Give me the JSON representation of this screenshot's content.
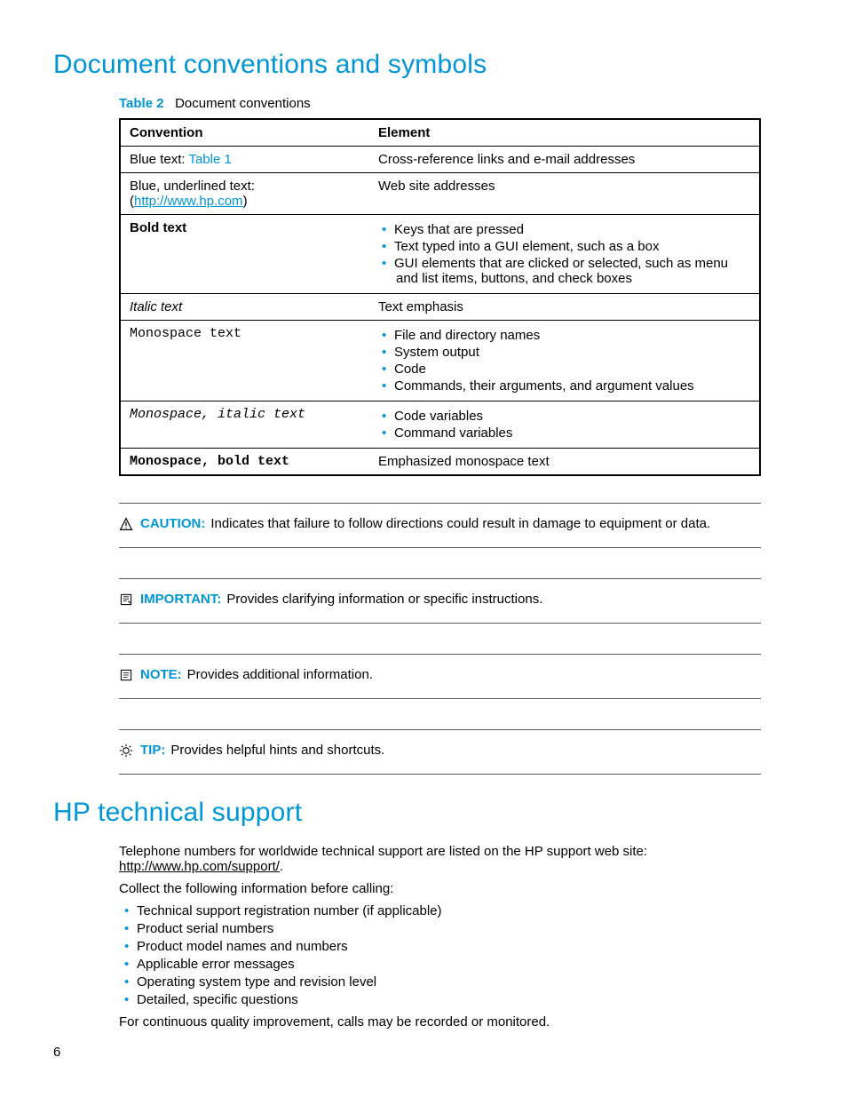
{
  "heading1": "Document conventions and symbols",
  "table_caption_label": "Table 2",
  "table_caption_text": "Document conventions",
  "th1": "Convention",
  "th2": "Element",
  "row1": {
    "conv_prefix": "Blue text: ",
    "conv_link": "Table 1",
    "elem": "Cross-reference links and e-mail addresses"
  },
  "row2": {
    "conv_line1": "Blue, underlined text:",
    "conv_link": "http://www.hp.com",
    "elem": "Web site addresses"
  },
  "row3": {
    "conv": "Bold text",
    "b1": "Keys that are pressed",
    "b2": "Text typed into a GUI element, such as a box",
    "b3": "GUI elements that are clicked or selected, such as menu and list items, buttons, and check boxes"
  },
  "row4": {
    "conv": "Italic text",
    "elem": "Text emphasis"
  },
  "row5": {
    "conv": "Monospace text",
    "b1": "File and directory names",
    "b2": "System output",
    "b3": "Code",
    "b4": "Commands, their arguments, and argument values"
  },
  "row6": {
    "conv": "Monospace, italic text",
    "b1": "Code variables",
    "b2": "Command variables"
  },
  "row7": {
    "conv": "Monospace, bold text",
    "elem": "Emphasized monospace text"
  },
  "adm1": {
    "label": "CAUTION:",
    "text": "Indicates that failure to follow directions could result in damage to equipment or data."
  },
  "adm2": {
    "label": "IMPORTANT:",
    "text": "Provides clarifying information or specific instructions."
  },
  "adm3": {
    "label": "NOTE:",
    "text": "Provides additional information."
  },
  "adm4": {
    "label": "TIP:",
    "text": "Provides helpful hints and shortcuts."
  },
  "heading2": "HP technical support",
  "support_p1a": "Telephone numbers for worldwide technical support are listed on the HP support web site: ",
  "support_link": "http://www.hp.com/support/",
  "support_p1b": ".",
  "support_p2": "Collect the following information before calling:",
  "sl1": "Technical support registration number (if applicable)",
  "sl2": "Product serial numbers",
  "sl3": "Product model names and numbers",
  "sl4": "Applicable error messages",
  "sl5": "Operating system type and revision level",
  "sl6": "Detailed, specific questions",
  "support_p3": "For continuous quality improvement, calls may be recorded or monitored.",
  "pagenum": "6"
}
